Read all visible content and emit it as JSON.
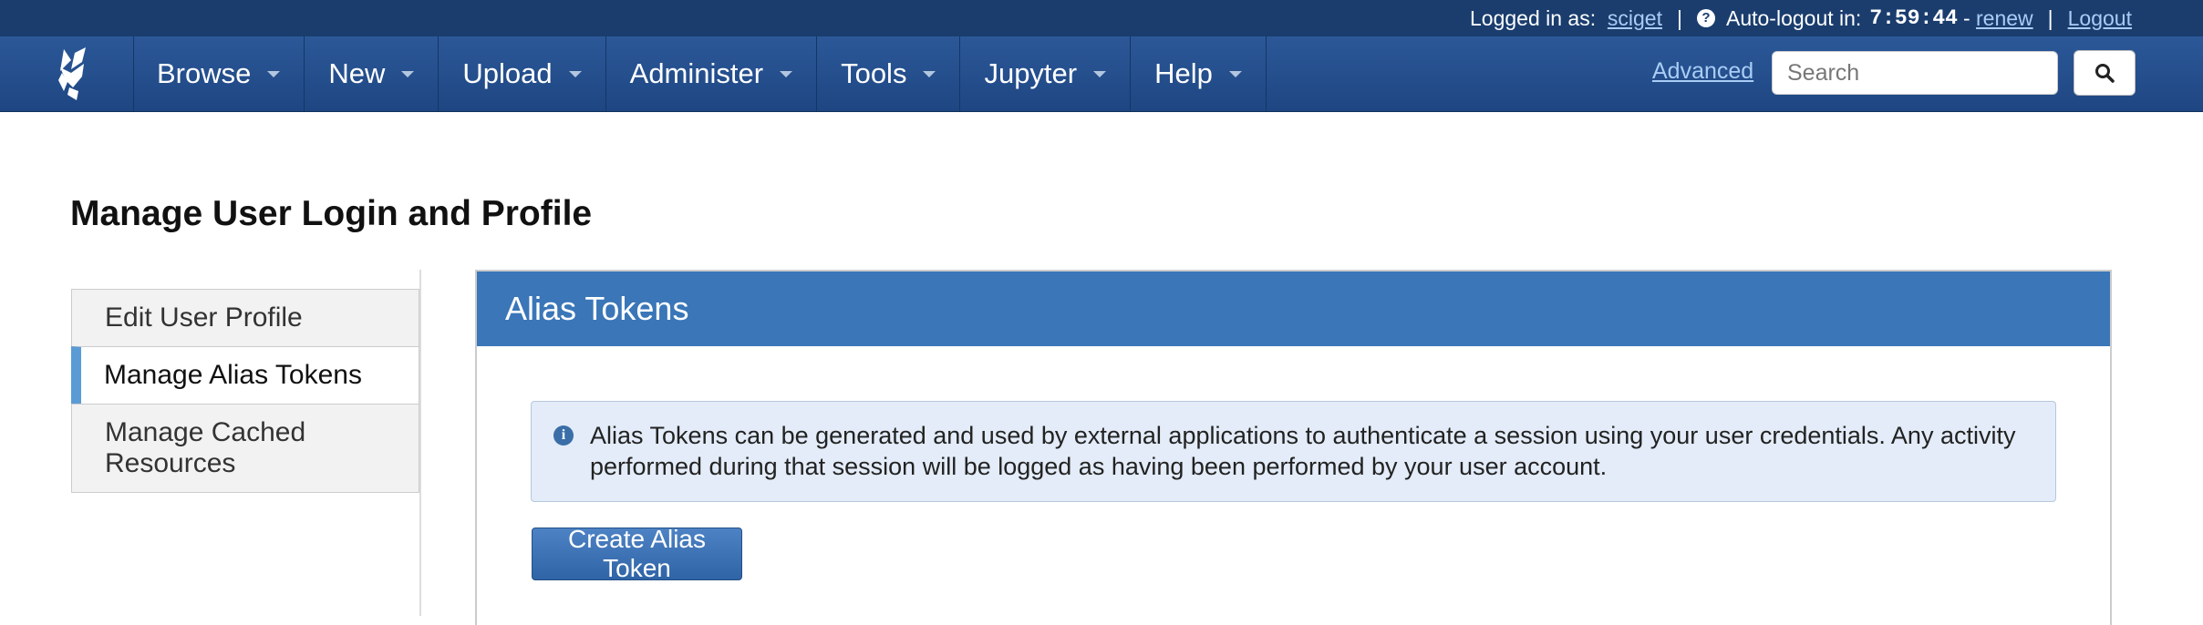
{
  "topbar": {
    "logged_in_label": "Logged in as:",
    "username": "sciget",
    "separator": "|",
    "auto_logout_label": "Auto-logout in:",
    "timer": "7:59:44",
    "dash": "-",
    "renew": "renew",
    "logout": "Logout"
  },
  "navbar": {
    "items": [
      {
        "label": "Browse"
      },
      {
        "label": "New"
      },
      {
        "label": "Upload"
      },
      {
        "label": "Administer"
      },
      {
        "label": "Tools"
      },
      {
        "label": "Jupyter"
      },
      {
        "label": "Help"
      }
    ],
    "advanced_link": "Advanced",
    "search_placeholder": "Search"
  },
  "page": {
    "title": "Manage User Login and Profile"
  },
  "sidebar": {
    "items": [
      {
        "label": "Edit User Profile",
        "active": false
      },
      {
        "label": "Manage Alias Tokens",
        "active": true
      },
      {
        "label": "Manage Cached Resources",
        "active": false
      }
    ]
  },
  "panel": {
    "title": "Alias Tokens",
    "info_text": "Alias Tokens can be generated and used by external applications to authenticate a session using your user credentials. Any activity performed during that session will be logged as having been performed by your user account.",
    "create_button": "Create Alias Token"
  },
  "colors": {
    "topbar_bg": "#1a3d6e",
    "navbar_bg": "#2c5898",
    "panel_header": "#3a76b8",
    "active_accent": "#5b9bd5",
    "alert_bg": "#e3ecf8",
    "link": "#a9cdf5"
  },
  "icons": {
    "logo": "galaxy-logo-icon",
    "help": "question-circle-icon",
    "search": "search-icon",
    "info": "info-circle-icon",
    "caret": "caret-down-icon"
  }
}
